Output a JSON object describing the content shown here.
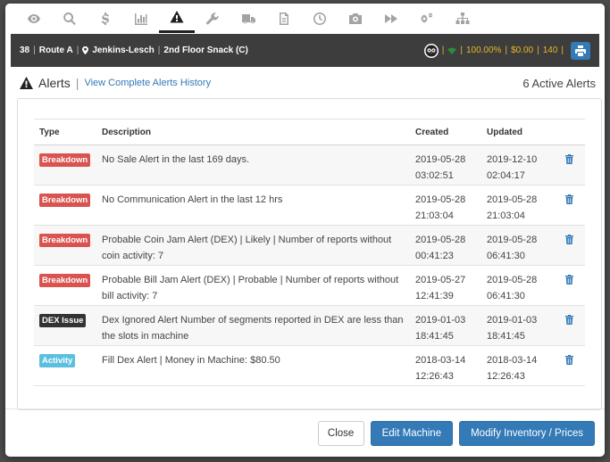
{
  "toolbar": {
    "tabs": [
      {
        "icon": "eye-icon"
      },
      {
        "icon": "search-icon"
      },
      {
        "icon": "dollar-icon"
      },
      {
        "icon": "bar-chart-icon"
      },
      {
        "icon": "warning-icon",
        "active": true
      },
      {
        "icon": "wrench-icon"
      },
      {
        "icon": "truck-icon"
      },
      {
        "icon": "document-icon"
      },
      {
        "icon": "clock-icon"
      },
      {
        "icon": "camera-icon"
      },
      {
        "icon": "fast-forward-icon"
      },
      {
        "icon": "gears-icon"
      },
      {
        "icon": "sitemap-icon"
      }
    ]
  },
  "infobar": {
    "machine_id": "38",
    "route": "Route A",
    "location": "Jenkins-Lesch",
    "machine_name": "2nd Floor Snack (C)",
    "percent": "100.00%",
    "amount": "$0.00",
    "count": "140"
  },
  "alerts": {
    "title": "Alerts",
    "history_link": "View Complete Alerts History",
    "active_count": "6 Active Alerts",
    "columns": {
      "type": "Type",
      "description": "Description",
      "created": "Created",
      "updated": "Updated"
    },
    "rows": [
      {
        "type": "Breakdown",
        "type_color": "#d9534f",
        "description": "No Sale Alert in the last 169 days.",
        "created_date": "2019-05-28",
        "created_time": "03:02:51",
        "updated_date": "2019-12-10",
        "updated_time": "02:04:17"
      },
      {
        "type": "Breakdown",
        "type_color": "#d9534f",
        "description": "No Communication Alert in the last 12 hrs",
        "created_date": "2019-05-28",
        "created_time": "21:03:04",
        "updated_date": "2019-05-28",
        "updated_time": "21:03:04"
      },
      {
        "type": "Breakdown",
        "type_color": "#d9534f",
        "description": "Probable Coin Jam Alert (DEX) | Likely | Number of reports without coin activity: 7",
        "created_date": "2019-05-28",
        "created_time": "00:41:23",
        "updated_date": "2019-05-28",
        "updated_time": "06:41:30"
      },
      {
        "type": "Breakdown",
        "type_color": "#d9534f",
        "description": "Probable Bill Jam Alert (DEX) | Probable | Number of reports without bill activity: 7",
        "created_date": "2019-05-27",
        "created_time": "12:41:39",
        "updated_date": "2019-05-28",
        "updated_time": "06:41:30"
      },
      {
        "type": "DEX Issue",
        "type_color": "#333333",
        "description": "Dex Ignored Alert Number of segments reported in DEX are less than the slots in machine",
        "created_date": "2019-01-03",
        "created_time": "18:41:45",
        "updated_date": "2019-01-03",
        "updated_time": "18:41:45"
      },
      {
        "type": "Activity",
        "type_color": "#5bc0de",
        "description": "Fill Dex Alert | Money in Machine: $80.50",
        "created_date": "2018-03-14",
        "created_time": "12:26:43",
        "updated_date": "2018-03-14",
        "updated_time": "12:26:43"
      }
    ]
  },
  "footer": {
    "close_label": "Close",
    "edit_label": "Edit Machine",
    "modify_label": "Modify Inventory / Prices"
  },
  "colors": {
    "primary": "#337ab7",
    "breakdown": "#d9534f",
    "dex_issue": "#333333",
    "activity": "#5bc0de",
    "stat_yellow": "#e8b923",
    "infobar_bg": "#3d3d3d"
  }
}
